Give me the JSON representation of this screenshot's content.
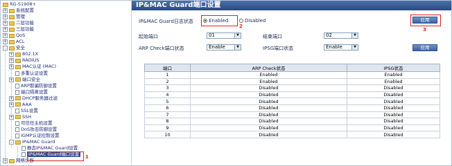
{
  "tree": {
    "root": "RG-S1908+",
    "items": [
      {
        "label": "系统配置",
        "toggle": "+",
        "icon": "folder"
      },
      {
        "label": "管理",
        "toggle": "+",
        "icon": "folder"
      },
      {
        "label": "二层功能",
        "toggle": "+",
        "icon": "folder"
      },
      {
        "label": "三层功能",
        "toggle": "+",
        "icon": "folder"
      },
      {
        "label": "QoS",
        "toggle": "+",
        "icon": "folder"
      },
      {
        "label": "ACL",
        "toggle": "+",
        "icon": "folder"
      },
      {
        "label": "安全",
        "toggle": "-",
        "icon": "folder"
      },
      {
        "label": "802.1X",
        "toggle": "+",
        "icon": "folder"
      },
      {
        "label": "RADIUS",
        "toggle": "+",
        "icon": "folder"
      },
      {
        "label": "MAC认证 (MAC)",
        "toggle": "+",
        "icon": "folder"
      },
      {
        "label": "多重认证设置",
        "toggle": "",
        "icon": "doc"
      },
      {
        "label": "端口安全",
        "toggle": "+",
        "icon": "folder"
      },
      {
        "label": "ARP欺骗防御设置",
        "toggle": "",
        "icon": "doc"
      },
      {
        "label": "端口隔离设置",
        "toggle": "",
        "icon": "doc"
      },
      {
        "label": "DHCP服务器过滤",
        "toggle": "+",
        "icon": "folder"
      },
      {
        "label": "AAA",
        "toggle": "+",
        "icon": "folder"
      },
      {
        "label": "SSL设置",
        "toggle": "",
        "icon": "doc"
      },
      {
        "label": "SSH",
        "toggle": "+",
        "icon": "folder"
      },
      {
        "label": "可信任主机设置",
        "toggle": "",
        "icon": "doc"
      },
      {
        "label": "DoS攻击防御设置",
        "toggle": "",
        "icon": "doc"
      },
      {
        "label": "IGMP认证控制设置",
        "toggle": "",
        "icon": "doc"
      },
      {
        "label": "IP&MAC Guard",
        "toggle": "-",
        "icon": "folder"
      },
      {
        "label": "静态IP&MAC Guard设置",
        "toggle": "",
        "icon": "doc"
      },
      {
        "label": "IP&MAC Guard端口设置",
        "toggle": "",
        "icon": "doc"
      },
      {
        "label": "网络诊断",
        "toggle": "+",
        "icon": "folder"
      }
    ]
  },
  "annotations": {
    "a1": "1",
    "a2": "2",
    "a3": "3"
  },
  "main": {
    "title": "IP&MAC Guard端口设置",
    "state_label": "IP&MAC Guard日志状态",
    "enabled_label": "Enabled",
    "disabled_label": "Disabled",
    "apply_label": "应用",
    "apply2_label": "应用",
    "start_port_label": "起始端口",
    "start_port_value": "01",
    "end_port_label": "结束端口",
    "end_port_value": "02",
    "arp_label": "ARP Check端口状态",
    "arp_value": "Enable",
    "ipsg_label": "IPSG端口状态",
    "ipsg_value": "Enable"
  },
  "table": {
    "headers": [
      "端口",
      "ARP Check状态",
      "IPSG状态"
    ],
    "rows": [
      [
        "1",
        "Enabled",
        "Enabled"
      ],
      [
        "2",
        "Enabled",
        "Enabled"
      ],
      [
        "3",
        "Disabled",
        "Disabled"
      ],
      [
        "4",
        "Disabled",
        "Disabled"
      ],
      [
        "5",
        "Disabled",
        "Disabled"
      ],
      [
        "6",
        "Disabled",
        "Disabled"
      ],
      [
        "7",
        "Disabled",
        "Disabled"
      ],
      [
        "8",
        "Disabled",
        "Disabled"
      ],
      [
        "9",
        "Disabled",
        "Disabled"
      ],
      [
        "10",
        "Disabled",
        "Disabled"
      ]
    ]
  }
}
